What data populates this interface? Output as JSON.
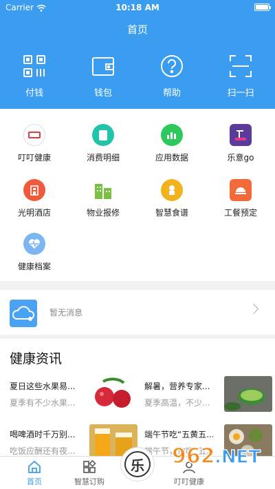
{
  "status_bar": {
    "carrier": "Carrier",
    "time": "10:18 AM"
  },
  "header": {
    "title": "首页"
  },
  "quick_actions": [
    {
      "label": "付钱",
      "icon": "qr-pay-icon"
    },
    {
      "label": "钱包",
      "icon": "wallet-icon"
    },
    {
      "label": "帮助",
      "icon": "help-icon"
    },
    {
      "label": "扫一扫",
      "icon": "scan-icon"
    }
  ],
  "services": [
    {
      "label": "叮叮健康",
      "icon": "dingding-health-icon",
      "color": "#e8e8e8"
    },
    {
      "label": "消费明细",
      "icon": "consumption-detail-icon",
      "color": "#21c4a8"
    },
    {
      "label": "应用数据",
      "icon": "app-data-icon",
      "color": "#2ec95c"
    },
    {
      "label": "乐意go",
      "icon": "leyigo-icon",
      "color": "#5b3b9a"
    },
    {
      "label": "光明酒店",
      "icon": "hotel-icon",
      "color": "#f05a3c"
    },
    {
      "label": "物业报修",
      "icon": "property-repair-icon",
      "color": "#7ac143"
    },
    {
      "label": "智慧食谱",
      "icon": "smart-recipe-icon",
      "color": "#f2b21b"
    },
    {
      "label": "工餐预定",
      "icon": "meal-booking-icon",
      "color": "#f36a3a"
    },
    {
      "label": "健康档案",
      "icon": "health-record-icon",
      "color": "#7bb6f2"
    }
  ],
  "message": {
    "text": "暂无消息"
  },
  "news": {
    "title": "健康资讯",
    "items": [
      {
        "title": "夏日这些水果易...",
        "summary": "夏季有不少水果...",
        "image": "lychee-image"
      },
      {
        "title": "解暑，营养专家...",
        "summary": "夏季高温，不少...",
        "image": "green-tea-image"
      },
      {
        "title": "喝啤酒时千万别...",
        "summary": "吃饭应酬还有夜...",
        "image": "beer-image"
      },
      {
        "title": "端午节吃“五黄五...",
        "summary": "端午节，你吃“五...",
        "image": "eggs-image"
      }
    ]
  },
  "tabbar": [
    {
      "label": "首页",
      "icon": "home-icon"
    },
    {
      "label": "智慧订购",
      "icon": "smart-order-icon"
    },
    {
      "label": "乐",
      "icon": "le-center-icon"
    },
    {
      "label": "叮叮健康",
      "icon": "profile-icon"
    }
  ],
  "colors": {
    "primary": "#3b9df0"
  }
}
